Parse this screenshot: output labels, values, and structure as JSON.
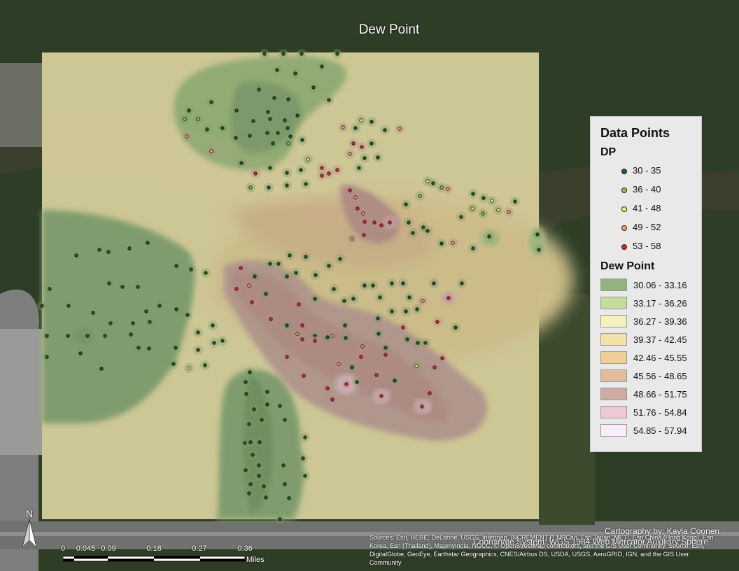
{
  "map": {
    "title": "Dew Point"
  },
  "legend": {
    "title": "Data Points",
    "points_heading": "DP",
    "point_classes": [
      {
        "label": "30 - 35",
        "color": "#1f5d22"
      },
      {
        "label": "36 - 40",
        "color": "#8fbf52"
      },
      {
        "label": "41 - 48",
        "color": "#f7ec6a"
      },
      {
        "label": "49 - 52",
        "color": "#f4a05a"
      },
      {
        "label": "53 - 58",
        "color": "#d8262a"
      }
    ],
    "surface_heading": "Dew Point",
    "surface_classes": [
      {
        "label": "30.06 - 33.16",
        "color": "#93b27e"
      },
      {
        "label": "33.17 - 36.26",
        "color": "#c6dc9c"
      },
      {
        "label": "36.27 - 39.36",
        "color": "#f4f1c0"
      },
      {
        "label": "39.37 - 42.45",
        "color": "#f1e2aa"
      },
      {
        "label": "42.46 - 45.55",
        "color": "#eecf98"
      },
      {
        "label": "45.56 - 48.65",
        "color": "#e1bd9e"
      },
      {
        "label": "48.66 - 51.75",
        "color": "#ceaaa3"
      },
      {
        "label": "51.76 - 54.84",
        "color": "#eec9d4"
      },
      {
        "label": "54.85 - 57.94",
        "color": "#f9eef8"
      }
    ]
  },
  "credits": {
    "cartography": "Cartography by: Kayla Coonen",
    "coordinate_system": "Coordinate System: WGS 1984 Web Mercator Auxiliary Sphere",
    "sources": "Sources: Esri, HERE, DeLorme, USGS, Intermap, INCREMENT P, NRCan, Esri Japan, METI, Esri China (Hong Kong), Esri Korea, Esri (Thailand), MapmyIndia, NGCC, © OpenStreetMap contributors, and the GIS User Community, Source: Esri, DigitalGlobe, GeoEye, Earthstar Geographics, CNES/Airbus DS, USDA, USGS, AeroGRID, IGN, and the GIS User Community"
  },
  "scale": {
    "ticks": [
      "0",
      "0.045",
      "0.09",
      "0.18",
      "0.27",
      "0.36"
    ],
    "tick_values": [
      0,
      0.045,
      0.09,
      0.18,
      0.27,
      0.36
    ],
    "units": "Miles"
  },
  "north_arrow": {
    "label": "N"
  }
}
